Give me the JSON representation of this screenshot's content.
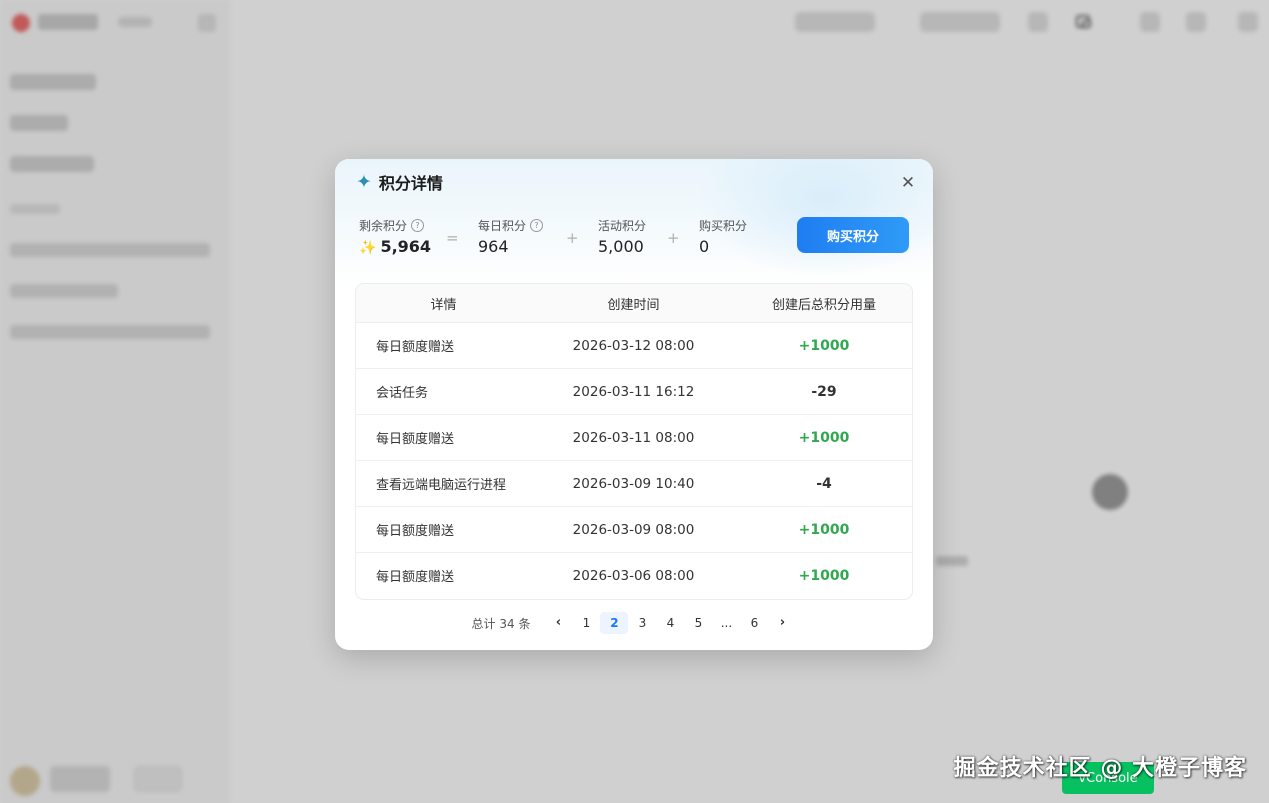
{
  "modal": {
    "title": "积分详情",
    "close_icon": "close-icon",
    "title_icon": "sparkle-icon",
    "stats": {
      "remaining": {
        "label": "剩余积分",
        "value": "5,964"
      },
      "daily": {
        "label": "每日积分",
        "value": "964"
      },
      "activity": {
        "label": "活动积分",
        "value": "5,000"
      },
      "purchased": {
        "label": "购买积分",
        "value": "0"
      },
      "eq": "=",
      "plus": "+"
    },
    "buy_button": "购买积分",
    "table": {
      "headers": [
        "详情",
        "创建时间",
        "创建后总积分用量"
      ],
      "rows": [
        {
          "detail": "每日额度赠送",
          "time": "2026-03-12 08:00",
          "change": "+1000"
        },
        {
          "detail": "会话任务",
          "time": "2026-03-11 16:12",
          "change": "-29"
        },
        {
          "detail": "每日额度赠送",
          "time": "2026-03-11 08:00",
          "change": "+1000"
        },
        {
          "detail": "查看远端电脑运行进程",
          "time": "2026-03-09 10:40",
          "change": "-4"
        },
        {
          "detail": "每日额度赠送",
          "time": "2026-03-09 08:00",
          "change": "+1000"
        },
        {
          "detail": "每日额度赠送",
          "time": "2026-03-06 08:00",
          "change": "+1000"
        }
      ]
    },
    "pagination": {
      "total": "总计 34 条",
      "pages": [
        "1",
        "2",
        "3",
        "4",
        "5",
        "...",
        "6"
      ],
      "current": "2",
      "prev": "‹",
      "next": "›"
    }
  },
  "watermark": "掘金技术社区 @ 大橙子博客",
  "vconsole": "vConsole",
  "colors": {
    "positive": "#2fa84f",
    "primary": "#1677ff",
    "vconsole": "#07c160"
  }
}
